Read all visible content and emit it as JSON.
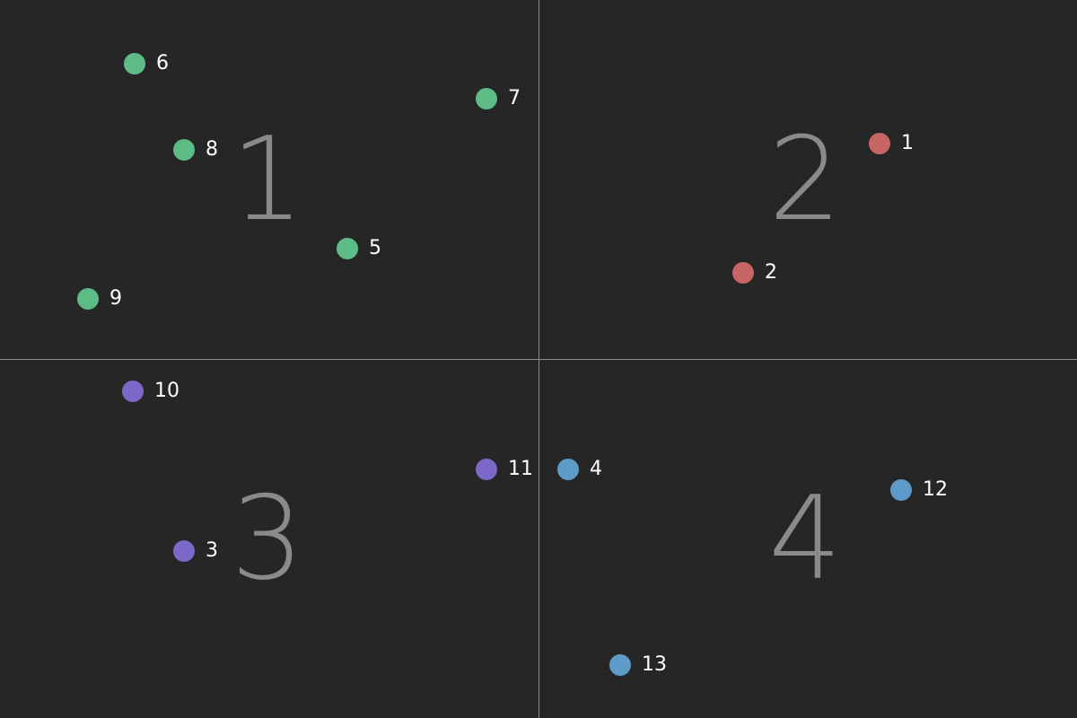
{
  "quadrants": [
    {
      "label": "1"
    },
    {
      "label": "2"
    },
    {
      "label": "3"
    },
    {
      "label": "4"
    }
  ],
  "colors": {
    "green": "#5dbb85",
    "red": "#c86565",
    "purple": "#7b68c8",
    "blue": "#5f9bc8"
  },
  "points": [
    {
      "label": "1",
      "group": "red"
    },
    {
      "label": "2",
      "group": "red"
    },
    {
      "label": "3",
      "group": "purple"
    },
    {
      "label": "4",
      "group": "blue"
    },
    {
      "label": "5",
      "group": "green"
    },
    {
      "label": "6",
      "group": "green"
    },
    {
      "label": "7",
      "group": "green"
    },
    {
      "label": "8",
      "group": "green"
    },
    {
      "label": "9",
      "group": "green"
    },
    {
      "label": "10",
      "group": "purple"
    },
    {
      "label": "11",
      "group": "purple"
    },
    {
      "label": "12",
      "group": "blue"
    },
    {
      "label": "13",
      "group": "blue"
    }
  ]
}
